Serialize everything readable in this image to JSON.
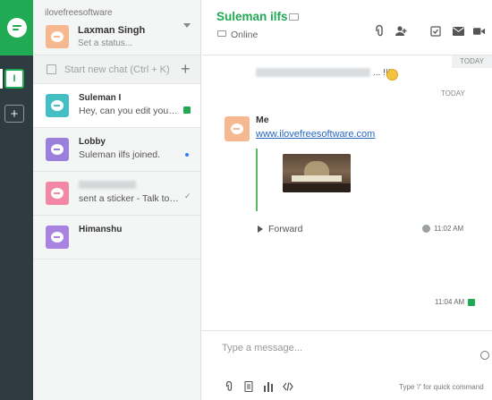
{
  "rail": {
    "team_initial": "I",
    "add_label": "+"
  },
  "profile": {
    "org_name": "ilovefreesoftware",
    "user_name": "Laxman Singh",
    "status_placeholder": "Set a status..."
  },
  "new_chat": {
    "label": "Start new chat (Ctrl + K)",
    "plus": "+"
  },
  "conversations": [
    {
      "title": "Suleman I",
      "preview": "Hey, can you edit your ...",
      "avatar_color": "#45bfc6",
      "indicator": "green-badge"
    },
    {
      "title": "Lobby",
      "preview": "Suleman ilfs joined.",
      "avatar_color": "#9a7fdc",
      "indicator": "blue-dot"
    },
    {
      "title": "",
      "preview": "sent a sticker - Talk to t...",
      "avatar_color": "#f287a7",
      "indicator": "check"
    },
    {
      "title": "Himanshu",
      "preview": "",
      "avatar_color": "#a883e2",
      "indicator": "none"
    }
  ],
  "header": {
    "name": "Suleman ilfs",
    "presence": "Online",
    "icons": [
      "attachment-icon",
      "add-user-icon",
      "task-icon",
      "mail-icon",
      "video-icon"
    ]
  },
  "messages": {
    "today_tag": "TODAY",
    "prev_message_tail": "... !!!",
    "today_label": "TODAY",
    "sender": "Me",
    "link": "www.ilovefreesoftware.com",
    "forward_label": "Forward",
    "time_first": "11:02 AM",
    "time_second": "11:04 AM"
  },
  "composer": {
    "placeholder": "Type a message...",
    "hint": "Type '/' for quick command",
    "tools": [
      "attachment-icon",
      "document-icon",
      "poll-icon",
      "code-icon"
    ]
  },
  "colors": {
    "brand": "#1faa53",
    "rail": "#2e3b40",
    "link": "#2767c4"
  }
}
